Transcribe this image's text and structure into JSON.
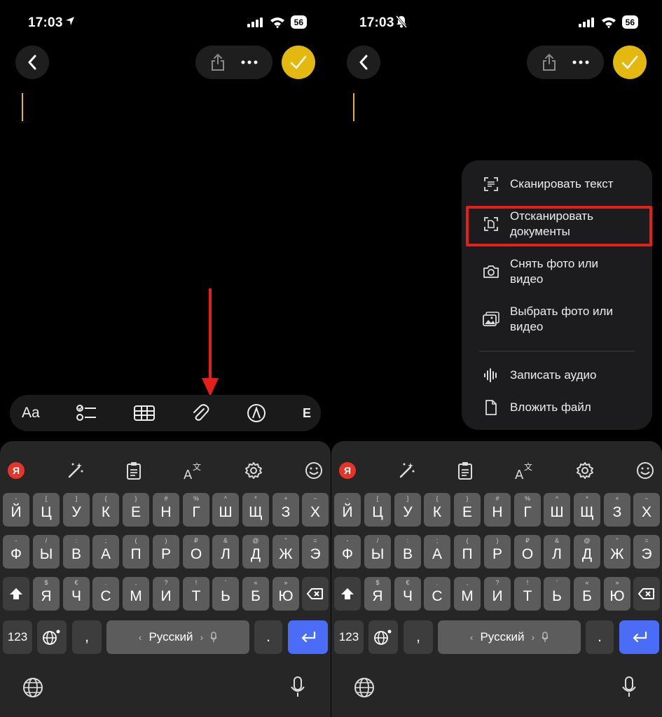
{
  "status": {
    "time": "17:03",
    "battery": "56"
  },
  "toolbar": {
    "format_label": "Aa",
    "edge_label": "E"
  },
  "menu": {
    "items": [
      {
        "label_line1": "Сканировать текст",
        "label_line2": ""
      },
      {
        "label_line1": "Отсканировать",
        "label_line2": "документы"
      },
      {
        "label_line1": "Снять фото или",
        "label_line2": "видео"
      },
      {
        "label_line1": "Выбрать фото или",
        "label_line2": "видео"
      },
      {
        "label_line1": "Записать аудио",
        "label_line2": ""
      },
      {
        "label_line1": "Вложить файл",
        "label_line2": ""
      }
    ],
    "highlight_color": "#e5201b"
  },
  "keyboard": {
    "yandex_label": "Я",
    "row1": [
      {
        "key": "Й",
        "hint": "-"
      },
      {
        "key": "Ц",
        "hint": "["
      },
      {
        "key": "У",
        "hint": "]"
      },
      {
        "key": "К",
        "hint": "{"
      },
      {
        "key": "Е",
        "hint": "}"
      },
      {
        "key": "Н",
        "hint": "#"
      },
      {
        "key": "Г",
        "hint": "%"
      },
      {
        "key": "Ш",
        "hint": "^"
      },
      {
        "key": "Щ",
        "hint": "*"
      },
      {
        "key": "З",
        "hint": "+"
      },
      {
        "key": "Х",
        "hint": "~"
      }
    ],
    "row2": [
      {
        "key": "Ф",
        "hint": "-"
      },
      {
        "key": "Ы",
        "hint": "/"
      },
      {
        "key": "В",
        "hint": ":"
      },
      {
        "key": "А",
        "hint": ";"
      },
      {
        "key": "П",
        "hint": "("
      },
      {
        "key": "Р",
        "hint": ")"
      },
      {
        "key": "О",
        "hint": "₽"
      },
      {
        "key": "Л",
        "hint": "&"
      },
      {
        "key": "Д",
        "hint": "@"
      },
      {
        "key": "Ж",
        "hint": "\""
      },
      {
        "key": "Э",
        "hint": "="
      }
    ],
    "row3": [
      {
        "key": "Я",
        "hint": "$"
      },
      {
        "key": "Ч",
        "hint": "€"
      },
      {
        "key": "С",
        "hint": "."
      },
      {
        "key": "М",
        "hint": ","
      },
      {
        "key": "И",
        "hint": "?"
      },
      {
        "key": "Т",
        "hint": "!"
      },
      {
        "key": "Ь",
        "hint": "'"
      },
      {
        "key": "Б",
        "hint": "«"
      },
      {
        "key": "Ю",
        "hint": "»"
      }
    ],
    "numbers_label": "123",
    "comma_label": ",",
    "space_label": "Русский",
    "space_left": "‹",
    "space_right": "›",
    "period_label": "."
  },
  "colors": {
    "accent_yellow": "#e4b90f",
    "return_blue": "#4a6cf7",
    "arrow_red": "#e5201b"
  }
}
